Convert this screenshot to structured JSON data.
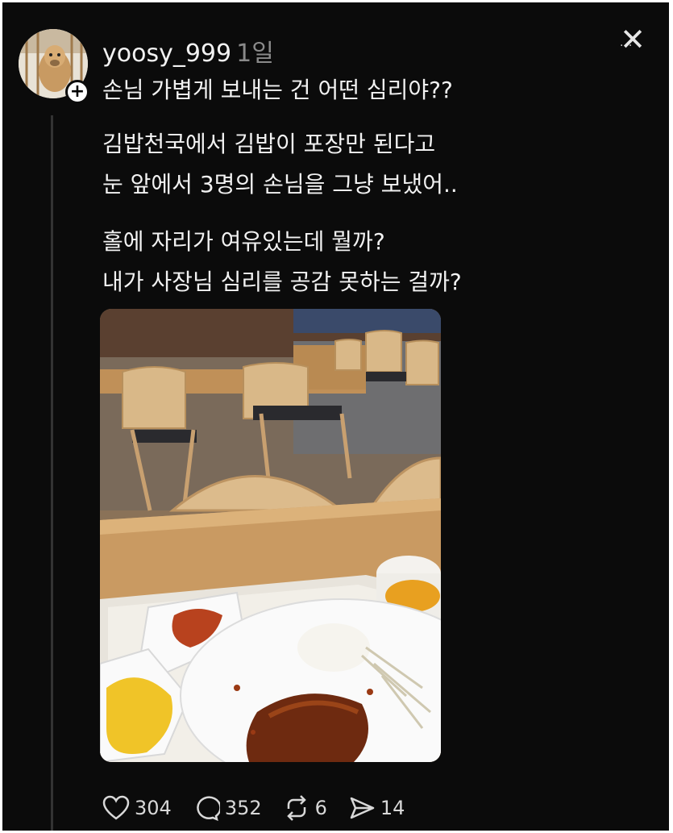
{
  "post": {
    "username": "yoosy_999",
    "time": "1일",
    "title": "손님 가볍게 보내는 건 어떤 심리야??",
    "para1": [
      "김밥천국에서 김밥이 포장만 된다고",
      "눈 앞에서 3명의 손님을 그냥 보냈어.."
    ],
    "para2": [
      "홀에 자리가 여유있는데 뭘까?",
      "내가 사장님 심리를 공감 못하는 걸까?"
    ]
  },
  "actions": {
    "likes": "304",
    "comments": "352",
    "reposts": "6",
    "shares": "14"
  },
  "icons": {
    "close": "close-icon",
    "like": "heart-icon",
    "comment": "comment-icon",
    "repost": "repost-icon",
    "share": "send-icon",
    "follow": "plus-icon"
  }
}
